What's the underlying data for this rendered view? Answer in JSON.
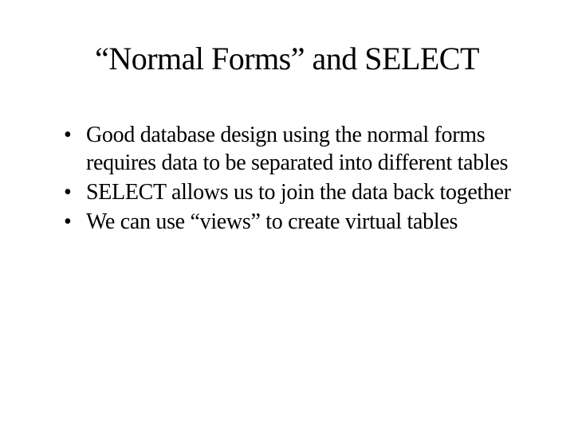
{
  "slide": {
    "title": "“Normal Forms” and SELECT",
    "bullets": [
      "Good database design using the normal forms requires data to be separated into different tables",
      "SELECT allows us to join the data back together",
      "We can use “views” to create virtual tables"
    ]
  }
}
